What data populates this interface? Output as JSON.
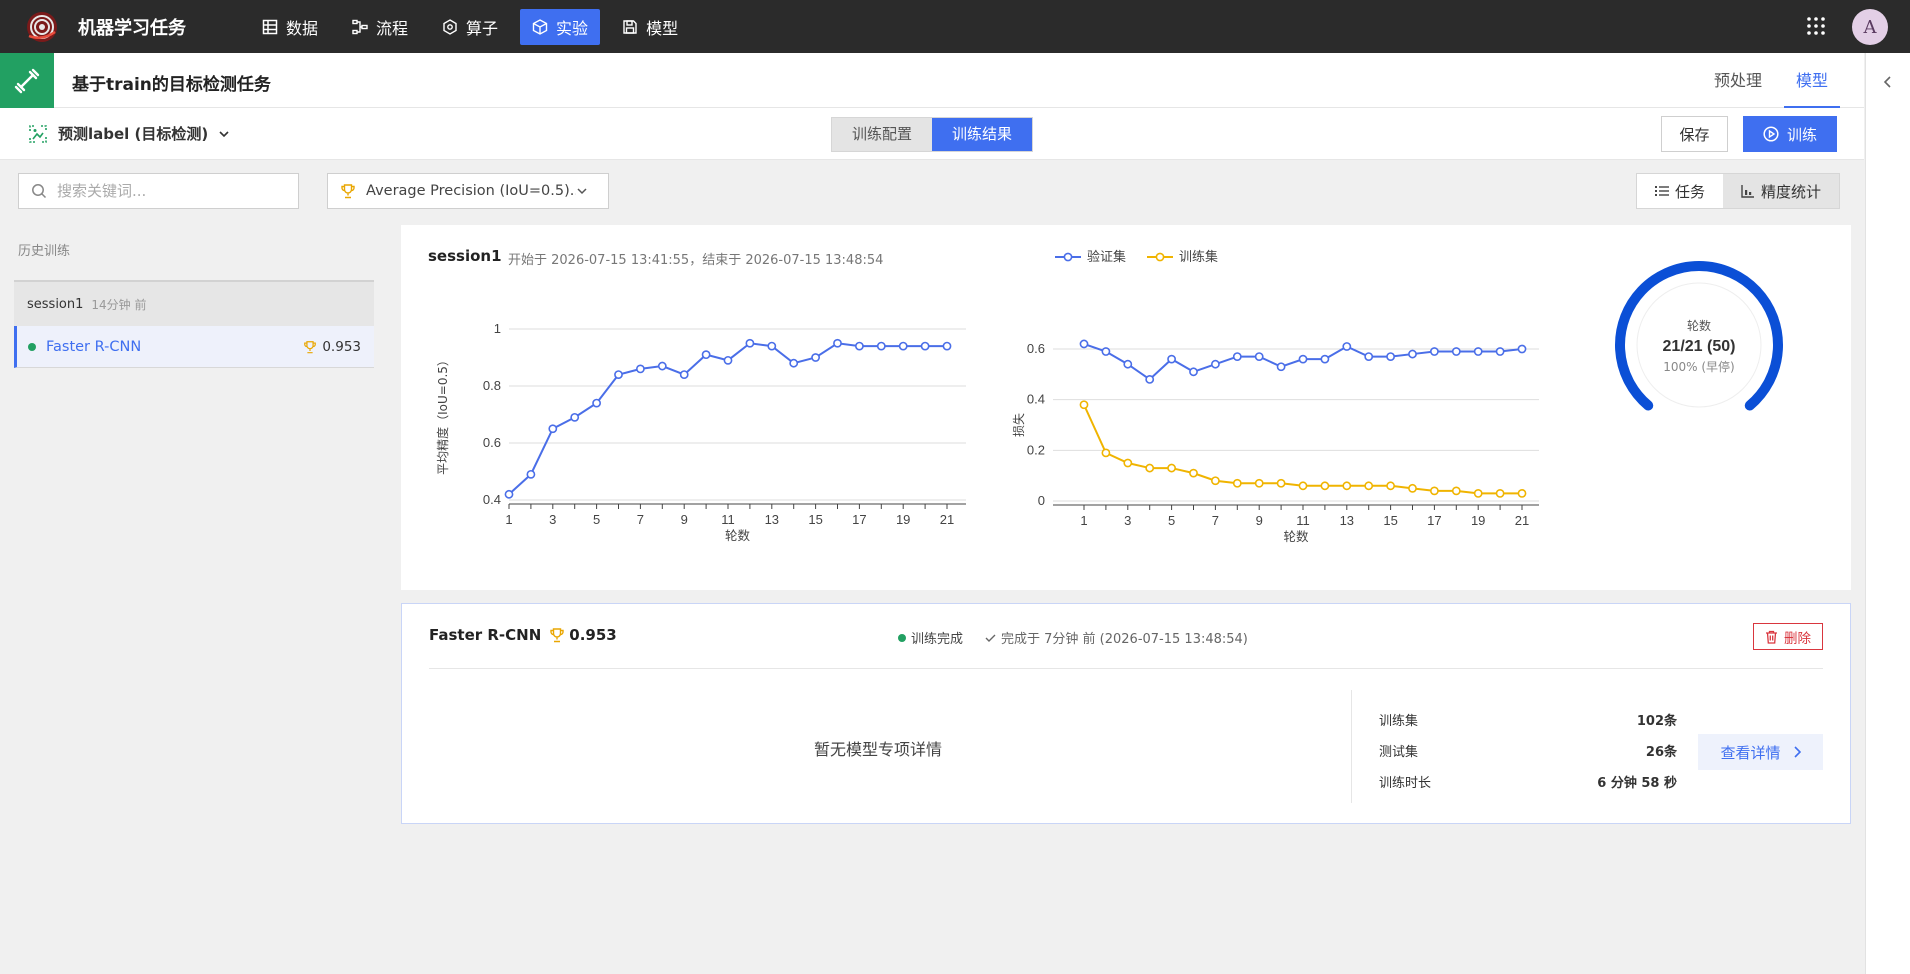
{
  "nav": {
    "app_title": "机器学习任务",
    "items": [
      {
        "label": "数据",
        "icon": "table-icon"
      },
      {
        "label": "流程",
        "icon": "flow-icon"
      },
      {
        "label": "算子",
        "icon": "hexagon-icon"
      },
      {
        "label": "实验",
        "icon": "cube-icon",
        "active": true
      },
      {
        "label": "模型",
        "icon": "save-icon"
      }
    ],
    "avatar": "A"
  },
  "task": {
    "title": "基于train的目标检测任务",
    "tabs": [
      "预处理",
      "模型"
    ],
    "active_tab": "模型"
  },
  "toolbar": {
    "label_select": "预测label (目标检测)",
    "segments": [
      "训练配置",
      "训练结果"
    ],
    "active_segment": "训练结果",
    "save_label": "保存",
    "train_label": "训练"
  },
  "filters": {
    "search_placeholder": "搜索关键词...",
    "metric": "Average Precision (IoU=0.5)...",
    "view_task": "任务",
    "view_precision": "精度统计"
  },
  "history": {
    "label": "历史训练",
    "session_name": "session1",
    "session_ago": "14分钟 前",
    "model_name": "Faster R-CNN",
    "model_score": "0.953"
  },
  "session": {
    "title": "session1",
    "time": "开始于  2026-07-15 13:41:55，结束于  2026-07-15 13:48:54"
  },
  "chart_data": [
    {
      "type": "line",
      "ylabel": "平均精度（IoU=0.5）",
      "xlabel": "轮数",
      "x": [
        1,
        2,
        3,
        4,
        5,
        6,
        7,
        8,
        9,
        10,
        11,
        12,
        13,
        14,
        15,
        16,
        17,
        18,
        19,
        20,
        21
      ],
      "xticks": [
        "1",
        "3",
        "5",
        "7",
        "9",
        "11",
        "13",
        "15",
        "17",
        "19",
        "21"
      ],
      "ylim": [
        0.4,
        1
      ],
      "yticks": [
        "0.4",
        "0.6",
        "0.8",
        "1"
      ],
      "series": [
        {
          "color": "#4a6ee8",
          "values": [
            0.42,
            0.49,
            0.65,
            0.69,
            0.74,
            0.84,
            0.86,
            0.87,
            0.84,
            0.91,
            0.89,
            0.95,
            0.94,
            0.88,
            0.9,
            0.95,
            0.94,
            0.94,
            0.94,
            0.94,
            0.94
          ]
        }
      ],
      "grid": true
    },
    {
      "type": "line",
      "ylabel": "损失",
      "xlabel": "轮数",
      "x": [
        1,
        2,
        3,
        4,
        5,
        6,
        7,
        8,
        9,
        10,
        11,
        12,
        13,
        14,
        15,
        16,
        17,
        18,
        19,
        20,
        21
      ],
      "xticks": [
        "1",
        "3",
        "5",
        "7",
        "9",
        "11",
        "13",
        "15",
        "17",
        "19",
        "21"
      ],
      "ylim": [
        0,
        0.6
      ],
      "yticks": [
        "0",
        "0.2",
        "0.4",
        "0.6"
      ],
      "legend": "top-left",
      "series": [
        {
          "name": "验证集",
          "color": "#4a6ee8",
          "values": [
            0.62,
            0.59,
            0.54,
            0.48,
            0.56,
            0.51,
            0.54,
            0.57,
            0.57,
            0.53,
            0.56,
            0.56,
            0.61,
            0.57,
            0.57,
            0.58,
            0.59,
            0.59,
            0.59,
            0.59,
            0.6
          ]
        },
        {
          "name": "训练集",
          "color": "#f0b400",
          "values": [
            0.38,
            0.19,
            0.15,
            0.13,
            0.13,
            0.11,
            0.08,
            0.07,
            0.07,
            0.07,
            0.06,
            0.06,
            0.06,
            0.06,
            0.06,
            0.05,
            0.04,
            0.04,
            0.03,
            0.03,
            0.03
          ]
        }
      ],
      "grid": true
    }
  ],
  "gauge": {
    "label": "轮数",
    "value": "21/21 (50)",
    "sub": "100% (早停)",
    "progress": 1.0,
    "color": "#0b4fd6"
  },
  "model_card": {
    "name": "Faster R-CNN",
    "score": "0.953",
    "status": "训练完成",
    "done": "完成于 7分钟 前 (2026-07-15 13:48:54)",
    "delete_label": "删除",
    "no_detail": "暂无模型专项详情",
    "stats": [
      {
        "k": "训练集",
        "v": "102条"
      },
      {
        "k": "测试集",
        "v": "26条"
      },
      {
        "k": "训练时长",
        "v": "6 分钟 58 秒"
      }
    ],
    "view_label": "查看详情"
  }
}
